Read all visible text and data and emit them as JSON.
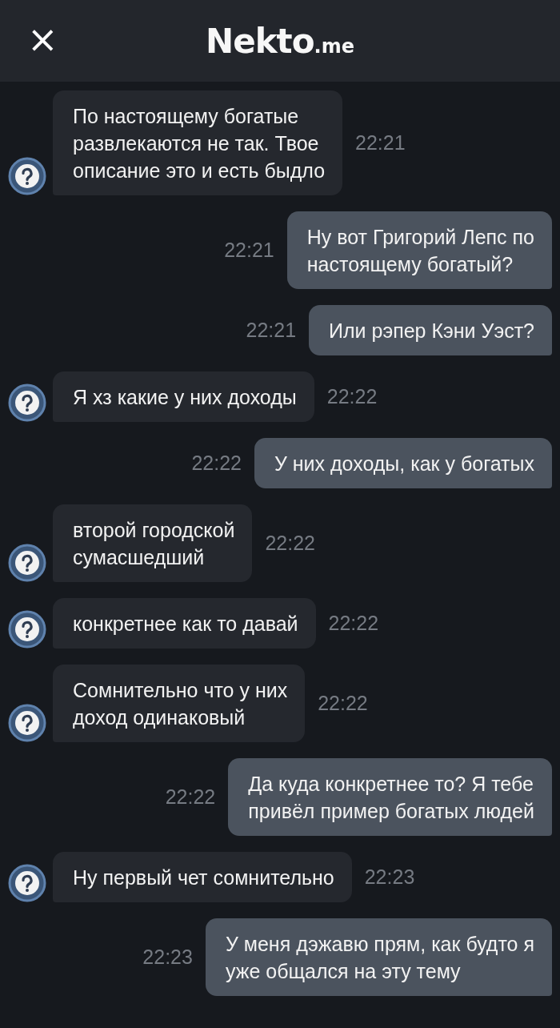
{
  "header": {
    "close": "×",
    "logo": {
      "name": "Nekto",
      "suffix": ".me"
    }
  },
  "messages": [
    {
      "kind": "incoming",
      "text": "По настоящему богатые\nразвлекаются не так. Твое\nописание это и есть быдло",
      "time": "22:21"
    },
    {
      "kind": "outgoing",
      "text": "Ну вот Григорий Лепс по\nнастоящему богатый?",
      "time": "22:21"
    },
    {
      "kind": "outgoing",
      "text": "Или рэпер Кэни Уэст?",
      "time": "22:21"
    },
    {
      "kind": "incoming",
      "text": "Я хз какие у них доходы",
      "time": "22:22"
    },
    {
      "kind": "outgoing",
      "text": "У них доходы, как у богатых",
      "time": "22:22"
    },
    {
      "kind": "incoming",
      "text": "второй городской\nсумасшедший",
      "time": "22:22"
    },
    {
      "kind": "incoming",
      "text": "конкретнее как то давай",
      "time": "22:22"
    },
    {
      "kind": "incoming",
      "text": "Сомнительно что у них\nдоход одинаковый",
      "time": "22:22"
    },
    {
      "kind": "outgoing",
      "text": "Да куда конкретнее то? Я тебе\nпривёл пример богатых людей",
      "time": "22:22"
    },
    {
      "kind": "incoming",
      "text": "Ну первый чет сомнительно",
      "time": "22:23"
    },
    {
      "kind": "outgoing",
      "text": "У меня дэжавю прям, как будто я\nуже общался на эту тему",
      "time": "22:23"
    }
  ]
}
